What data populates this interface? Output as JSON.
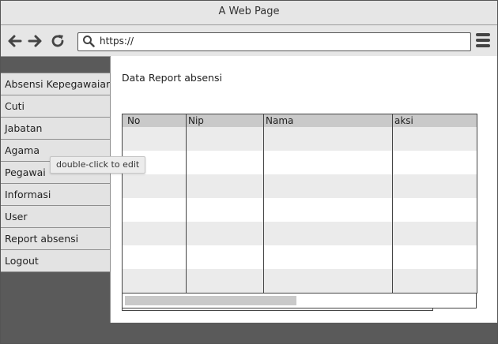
{
  "window": {
    "title": "A Web Page"
  },
  "browser": {
    "url": "https://"
  },
  "sidebar": {
    "items": [
      {
        "label": "Absensi Kepegawaian"
      },
      {
        "label": "Cuti"
      },
      {
        "label": "Jabatan"
      },
      {
        "label": "Agama"
      },
      {
        "label": "Pegawai"
      },
      {
        "label": "Informasi"
      },
      {
        "label": "User"
      },
      {
        "label": "Report absensi"
      },
      {
        "label": "Logout"
      }
    ]
  },
  "main": {
    "heading": "Data Report absensi",
    "table": {
      "columns": [
        "No",
        "Nip",
        "Nama",
        "aksi"
      ],
      "rows": []
    }
  },
  "tooltip": {
    "text": "double-click to edit"
  }
}
